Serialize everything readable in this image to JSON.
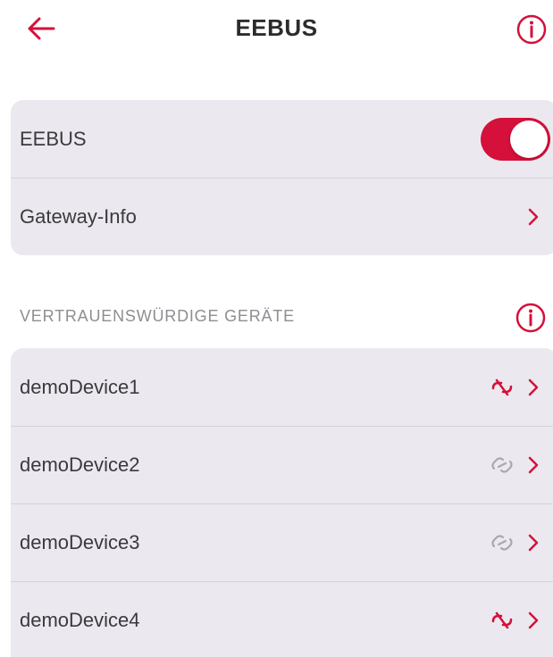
{
  "header": {
    "title": "EEBUS",
    "back_icon": "arrow-left-icon",
    "info_icon": "info-circle-icon"
  },
  "settings": {
    "eebus_toggle": {
      "label": "EEBUS",
      "enabled": true
    },
    "gateway_info": {
      "label": "Gateway-Info"
    }
  },
  "devices_section": {
    "header": "VERTRAUENSWÜRDIGE GERÄTE",
    "info_icon": "info-circle-icon",
    "devices": [
      {
        "name": "demoDevice1",
        "status_icon": "link-broken-icon",
        "status_color": "#d5103a"
      },
      {
        "name": "demoDevice2",
        "status_icon": "link-icon",
        "status_color": "#a8a8ad"
      },
      {
        "name": "demoDevice3",
        "status_icon": "link-icon",
        "status_color": "#a8a8ad"
      },
      {
        "name": "demoDevice4",
        "status_icon": "link-broken-icon",
        "status_color": "#d5103a"
      }
    ]
  },
  "colors": {
    "accent": "#d5103a",
    "card_background": "#ebe9ef",
    "secondary_text": "#8e8e93"
  }
}
